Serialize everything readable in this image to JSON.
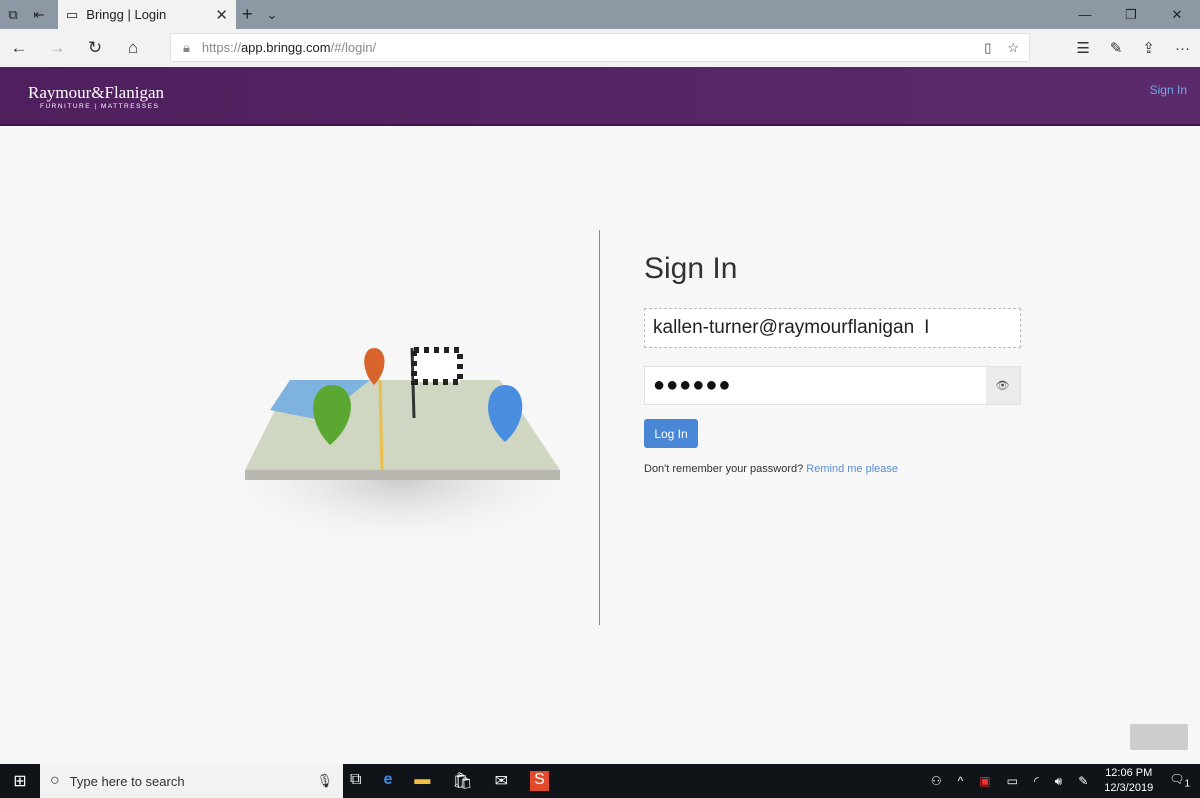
{
  "browser": {
    "tab_title": "Bringg | Login",
    "url_prefix": "https://",
    "url_host": "app.bringg.com",
    "url_path": "/#/login/"
  },
  "header": {
    "logo_name": "Raymour&Flanigan",
    "logo_sub": "FURNITURE | MATTRESSES",
    "sign_in_link": "Sign In",
    "brand_color": "#52225f"
  },
  "form": {
    "title": "Sign In",
    "email_value": "kallen-turner@raymourflanigan",
    "password_value": "●●●●●●",
    "login_label": "Log In",
    "forgot_text": "Don't remember your password?",
    "remind_link": "Remind me please",
    "accent_color": "#4a86d6"
  },
  "taskbar": {
    "search_placeholder": "Type here to search",
    "time": "12:06 PM",
    "date": "12/3/2019",
    "notification_count": "1"
  }
}
